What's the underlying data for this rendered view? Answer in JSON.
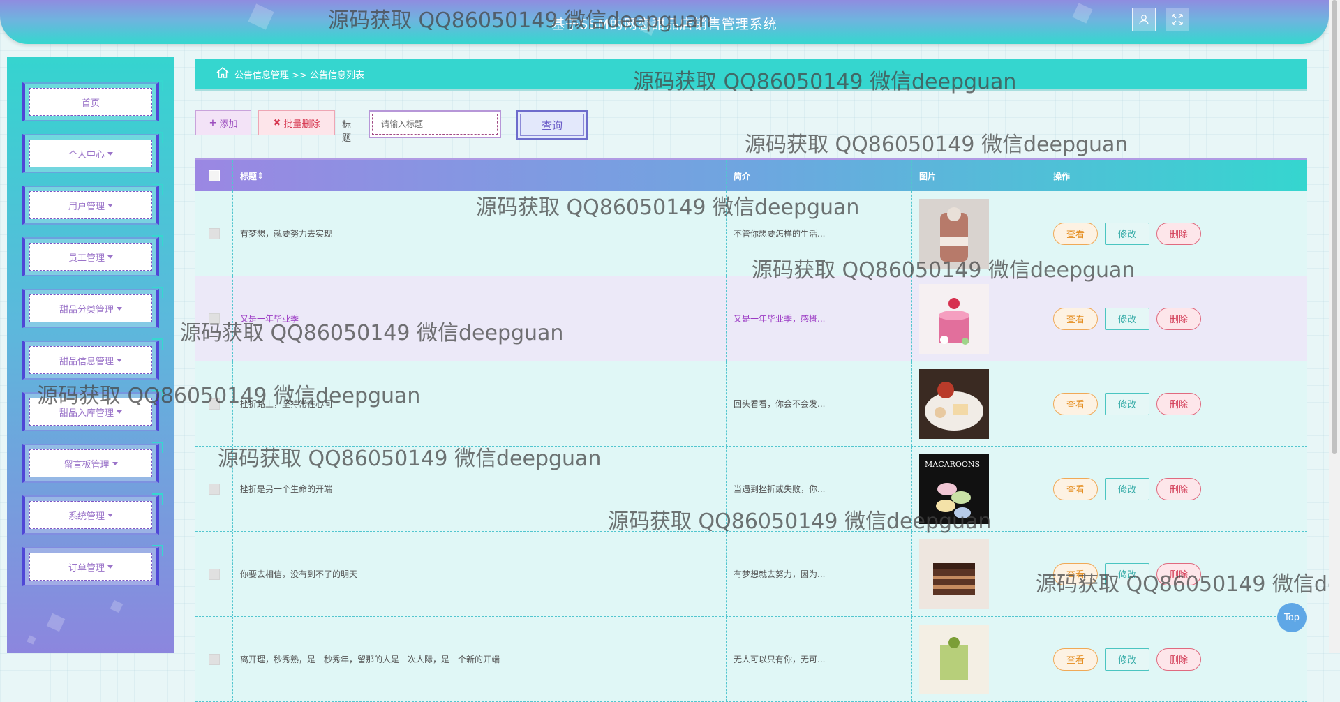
{
  "header": {
    "title": "基于SSM的网恋甜品店销售管理系统"
  },
  "sidebar": {
    "items": [
      {
        "label": "首页",
        "has_caret": false
      },
      {
        "label": "个人中心",
        "has_caret": true
      },
      {
        "label": "用户管理",
        "has_caret": true
      },
      {
        "label": "员工管理",
        "has_caret": true
      },
      {
        "label": "甜品分类管理",
        "has_caret": true
      },
      {
        "label": "甜品信息管理",
        "has_caret": true
      },
      {
        "label": "甜品入库管理",
        "has_caret": true
      },
      {
        "label": "留言板管理",
        "has_caret": true
      },
      {
        "label": "系统管理",
        "has_caret": true
      },
      {
        "label": "订单管理",
        "has_caret": true
      }
    ]
  },
  "breadcrumb": {
    "text": "公告信息管理 >> 公告信息列表"
  },
  "toolbar": {
    "add_label": "添加",
    "batch_delete_label": "批量删除",
    "title_label": "标题",
    "search_placeholder": "请输入标题",
    "query_label": "查询"
  },
  "table": {
    "headers": [
      "标题",
      "简介",
      "图片",
      "操作"
    ],
    "rows": [
      {
        "title": "有梦想，就要努力去实现",
        "intro": "不管你想要怎样的生活...",
        "image": "cake-jar",
        "highlight": false
      },
      {
        "title": "又是一年毕业季",
        "intro": "又是一年毕业季，感概...",
        "image": "pink-cake",
        "highlight": true
      },
      {
        "title": "挫折路上，坚持常在心间",
        "intro": "回头看看，你会不会发...",
        "image": "dessert-plate",
        "highlight": false
      },
      {
        "title": "挫折是另一个生命的开端",
        "intro": "当遇到挫折或失败，你...",
        "image": "macarons",
        "highlight": false
      },
      {
        "title": "你要去相信，没有到不了的明天",
        "intro": "有梦想就去努力，因为...",
        "image": "chocolate-cake",
        "highlight": false
      },
      {
        "title": "离开理，秒秀熟，是一秒秀年，留那的人是一次人际，是一个新的开端",
        "intro": "无人可以只有你，无可...",
        "image": "matcha-dessert",
        "highlight": false
      }
    ],
    "actions": {
      "view": "查看",
      "edit": "修改",
      "delete": "删除"
    }
  },
  "watermark": "源码获取 QQ86050149 微信deepguan",
  "top_button": "Top",
  "colors": {
    "accent": "#35d6cf",
    "primary_purple": "#7c54c4",
    "danger": "#d33f59"
  }
}
